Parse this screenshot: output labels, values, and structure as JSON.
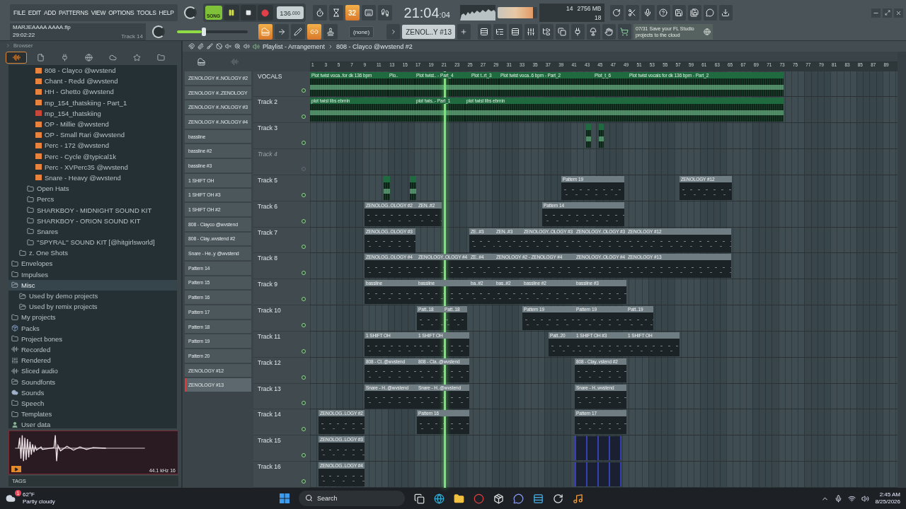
{
  "menu": [
    "FILE",
    "EDIT",
    "ADD",
    "PATTERNS",
    "VIEW",
    "OPTIONS",
    "TOOLS",
    "HELP"
  ],
  "project": {
    "file": "MARJEAAAA AAAA.flp",
    "time": "29:02:22",
    "track": "Track 14"
  },
  "transport": {
    "song_mode": true,
    "mode_label": "SONG",
    "playing": true,
    "tempo": "136",
    "tempo_fraction": ".000"
  },
  "toggles": [
    {
      "kind": "metronome",
      "on": false
    },
    {
      "kind": "wait",
      "on": false
    },
    {
      "kind": "step",
      "label": "32",
      "on": true
    },
    {
      "kind": "typing",
      "on": false
    },
    {
      "kind": "countdown",
      "on": false
    }
  ],
  "clock": {
    "main": "21:04",
    "sub": ":04"
  },
  "output_meter": {
    "level": 0.9
  },
  "master_volume": {
    "level": 0.35
  },
  "cpu": {
    "polyphony": "14",
    "memory": "2756 MB",
    "voices": "18"
  },
  "tools": [
    {
      "kind": "piano",
      "on": true
    },
    {
      "kind": "arrow",
      "on": false
    },
    {
      "kind": "pen",
      "on": false
    },
    {
      "kind": "link",
      "on": true
    },
    {
      "kind": "stamp",
      "on": false
    }
  ],
  "snap": "(none)",
  "pattern": "ZENOL..Y #13",
  "hint": {
    "counter": "07/31",
    "text": "Save your FL Studio projects to the cloud"
  },
  "browser": {
    "title": "Browser",
    "tabs": [
      {
        "kind": "wave",
        "selected": true
      },
      {
        "kind": "file",
        "selected": false
      },
      {
        "kind": "plug",
        "selected": false
      },
      {
        "kind": "globe",
        "selected": false
      },
      {
        "kind": "cloud",
        "selected": false
      },
      {
        "kind": "star",
        "selected": false
      },
      {
        "kind": "folder",
        "selected": false
      }
    ],
    "tree": [
      {
        "children": [
          {
            "children": [
              {
                "children": [
                  {
                    "label": "808 - Clayco @wvstend",
                    "kind": "file",
                    "selected": false
                  },
                  {
                    "label": "Chant - Redd @wvstend",
                    "kind": "file",
                    "selected": false
                  },
                  {
                    "label": "HH - Ghetto @wvstend",
                    "kind": "file",
                    "selected": false
                  },
                  {
                    "label": "mp_154_thatskiing - Part_1",
                    "kind": "file",
                    "selected": false
                  },
                  {
                    "label": "mp_154_thatskiing",
                    "kind": "audio",
                    "selected": false
                  },
                  {
                    "label": "OP - Millie @wvstend",
                    "kind": "file",
                    "selected": false
                  },
                  {
                    "label": "OP - Small Rari @wvstend",
                    "kind": "file",
                    "selected": false
                  },
                  {
                    "label": "Perc - 172 @wvstend",
                    "kind": "file",
                    "selected": false
                  },
                  {
                    "label": "Perc - Cycle @typical1k",
                    "kind": "file",
                    "selected": false
                  },
                  {
                    "label": "Perc - XVPerc35 @wvstend",
                    "kind": "file",
                    "selected": false
                  },
                  {
                    "label": "Snare - Heavy @wvstend",
                    "kind": "file",
                    "selected": false
                  }
                ]
              },
              {
                "label": "Open Hats",
                "kind": "folder",
                "selected": false
              },
              {
                "label": "Percs",
                "kind": "folder",
                "selected": false
              },
              {
                "label": "SHARKBOY - MIDNIGHT SOUND KIT",
                "kind": "folder",
                "selected": false
              },
              {
                "label": "SHARKBOY - ORION SOUND KIT",
                "kind": "folder",
                "selected": false
              },
              {
                "label": "Snares",
                "kind": "folder",
                "selected": false
              },
              {
                "label": "''SPYRAL'' SOUND KIT [@hitgirlsworld]",
                "kind": "folder",
                "selected": false
              }
            ]
          },
          {
            "label": "z. One Shots",
            "kind": "folder",
            "selected": false
          }
        ]
      },
      {
        "label": "Envelopes",
        "kind": "folder",
        "selected": false
      },
      {
        "label": "Impulses",
        "kind": "folder",
        "selected": false
      },
      {
        "label": "Misc",
        "kind": "plain",
        "selected": true,
        "children": [
          {
            "label": "Used by demo projects",
            "kind": "plain",
            "selected": false
          },
          {
            "label": "Used by remix projects",
            "kind": "plain",
            "selected": false
          }
        ]
      },
      {
        "label": "My projects",
        "kind": "folder",
        "selected": false
      },
      {
        "label": "Packs",
        "kind": "pack",
        "selected": false
      },
      {
        "label": "Project bones",
        "kind": "folder",
        "selected": false
      },
      {
        "label": "Recorded",
        "kind": "wave",
        "selected": false
      },
      {
        "label": "Rendered",
        "kind": "render",
        "selected": false
      },
      {
        "label": "Sliced audio",
        "kind": "wave",
        "selected": false
      },
      {
        "label": "Soundfonts",
        "kind": "plain",
        "selected": false
      },
      {
        "label": "Sounds",
        "kind": "cloud",
        "selected": false
      },
      {
        "label": "Speech",
        "kind": "folder",
        "selected": false
      },
      {
        "label": "Templates",
        "kind": "folder",
        "selected": false
      },
      {
        "label": "User data",
        "kind": "user",
        "selected": false
      }
    ],
    "preview": {
      "info": "44.1 kHz 16"
    },
    "tags": "TAGS"
  },
  "playlist": {
    "title": "Playlist - Arrangement",
    "pattern": "808 - Clayco @wvstend #2",
    "picker": [
      {
        "label": "ZENOLOGY #..NOLOGY #2",
        "selected": false
      },
      {
        "label": "ZENOLOGY #..ZENOLOGY",
        "selected": false
      },
      {
        "label": "ZENOLOGY #..NOLOGY #3",
        "selected": false
      },
      {
        "label": "ZENOLOGY #..NOLOGY #4",
        "selected": false
      },
      {
        "label": "bassline",
        "selected": false
      },
      {
        "label": "bassline #2",
        "selected": false
      },
      {
        "label": "bassline #3",
        "selected": false
      },
      {
        "label": "1 SHIFT OH",
        "selected": false
      },
      {
        "label": "1 SHIFT OH #3",
        "selected": false
      },
      {
        "label": "1 SHIFT OH #2",
        "selected": false
      },
      {
        "label": "808 - Clayco @wvstend",
        "selected": false
      },
      {
        "label": "808 - Clay..wvstend #2",
        "selected": false
      },
      {
        "label": "Snare - He..y @wvstend",
        "selected": false
      },
      {
        "label": "Pattern 14",
        "selected": false
      },
      {
        "label": "Pattern 15",
        "selected": false
      },
      {
        "label": "Pattern 16",
        "selected": false
      },
      {
        "label": "Pattern 17",
        "selected": false
      },
      {
        "label": "Pattern 18",
        "selected": false
      },
      {
        "label": "Pattern 19",
        "selected": false
      },
      {
        "label": "Pattern 20",
        "selected": false
      },
      {
        "label": "ZENOLOGY #12",
        "selected": false
      },
      {
        "label": "ZENOLOGY #13",
        "selected": true
      }
    ],
    "ruler": [
      "1",
      "3",
      "5",
      "7",
      "9",
      "11",
      "13",
      "15",
      "17",
      "19",
      "21",
      "23",
      "25",
      "27",
      "29",
      "31",
      "33",
      "35",
      "37",
      "39",
      "41",
      "43",
      "45",
      "47",
      "49",
      "51",
      "53",
      "55",
      "57",
      "59",
      "61",
      "63",
      "65",
      "67",
      "69",
      "71",
      "73",
      "75",
      "77",
      "79",
      "81",
      "83",
      "85",
      "87",
      "89"
    ],
    "tracks": [
      {
        "name": "VOCALS",
        "muted": false,
        "clips": [
          {
            "kind": "audio",
            "label": "Plot twist voca..for dk 136 bpm"
          },
          {
            "kind": "audio",
            "label": "Plo.."
          },
          {
            "kind": "audio",
            "label": "Plot twist.. - Part_4"
          },
          {
            "kind": "audio",
            "label": "Plot t..rt_3"
          },
          {
            "kind": "audio",
            "label": "Plot twist voca..6 bpm - Part_2"
          },
          {
            "kind": "audio"
          },
          {
            "kind": "audio",
            "label": "Plot_t_6"
          },
          {
            "kind": "audio",
            "label": "Plot twist vocals for dk 136 bpm - Part_2"
          }
        ]
      },
      {
        "name": "Track 2",
        "muted": false,
        "clips": [
          {
            "kind": "audio",
            "label": "plot twist libs ebmin"
          },
          {
            "kind": "audio",
            "label": "plot twis..- Part_1"
          },
          {
            "kind": "audio",
            "label": "plot twist libs ebmin"
          }
        ]
      },
      {
        "name": "Track 3",
        "muted": false,
        "clips": [
          {
            "kind": "audio"
          },
          {
            "kind": "audio"
          }
        ]
      },
      {
        "name": "Track 4",
        "muted": true
      },
      {
        "name": "Track 5",
        "muted": false,
        "clips": [
          {
            "kind": "audio"
          },
          {
            "kind": "audio"
          },
          {
            "kind": "pattern",
            "label": "Pattern 19"
          },
          {
            "kind": "pattern",
            "label": "ZENOLOGY #12"
          }
        ]
      },
      {
        "name": "Track 6",
        "muted": false,
        "clips": [
          {
            "kind": "pattern",
            "label": "ZENOLOG..OLOGY #2"
          },
          {
            "kind": "pattern",
            "label": "ZEN..#2"
          },
          {
            "kind": "pattern",
            "label": "Pattern 14"
          }
        ]
      },
      {
        "name": "Track 7",
        "muted": false,
        "clips": [
          {
            "kind": "pattern",
            "label": "ZENOLOG..OLOGY #3"
          },
          {
            "kind": "pattern",
            "label": "ZE..#3"
          },
          {
            "kind": "pattern",
            "label": "ZEN..#3"
          },
          {
            "kind": "pattern",
            "label": "ZENOLOGY..OLOGY #3"
          },
          {
            "kind": "pattern",
            "label": "ZENOLOGY..OLOGY #3"
          },
          {
            "kind": "pattern",
            "label": "ZENOLOGY #12"
          }
        ]
      },
      {
        "name": "Track 8",
        "muted": false,
        "clips": [
          {
            "kind": "pattern",
            "label": "ZENOLOG..OLOGY #4"
          },
          {
            "kind": "pattern",
            "label": "ZENOLOGY..OLOGY #4"
          },
          {
            "kind": "pattern",
            "label": "ZE..#4"
          },
          {
            "kind": "pattern",
            "label": "ZENOLOGY #2 - ZENOLOGY #4"
          },
          {
            "kind": "pattern",
            "label": "ZENOLOGY..OLOGY #4"
          },
          {
            "kind": "pattern",
            "label": "ZENOLOGY #13"
          }
        ]
      },
      {
        "name": "Track 9",
        "muted": false,
        "clips": [
          {
            "kind": "pattern",
            "label": "bassline"
          },
          {
            "kind": "pattern",
            "label": "bassline"
          },
          {
            "kind": "pattern",
            "label": "ba..#2"
          },
          {
            "kind": "pattern",
            "label": "bas..#2"
          },
          {
            "kind": "pattern",
            "label": "bassline #2"
          },
          {
            "kind": "pattern",
            "label": "bassline #3"
          }
        ]
      },
      {
        "name": "Track 10",
        "muted": false,
        "clips": [
          {
            "kind": "pattern",
            "label": "Patt..18"
          },
          {
            "kind": "pattern",
            "label": "Patt..18"
          },
          {
            "kind": "pattern",
            "label": "Pattern 19"
          },
          {
            "kind": "pattern",
            "label": "Pattern 19"
          },
          {
            "kind": "pattern",
            "label": "Patt..19"
          }
        ]
      },
      {
        "name": "Track 11",
        "muted": false,
        "clips": [
          {
            "kind": "pattern",
            "label": "1 SHIFT OH"
          },
          {
            "kind": "pattern",
            "label": "1 SHIFT OH"
          },
          {
            "kind": "pattern",
            "label": "Patt..20"
          },
          {
            "kind": "pattern",
            "label": "1 SHIFT OH #3"
          },
          {
            "kind": "pattern",
            "label": "1 SHIFT OH"
          }
        ]
      },
      {
        "name": "Track 12",
        "muted": false,
        "clips": [
          {
            "kind": "pattern",
            "label": "808 - Cl..@wvstend"
          },
          {
            "kind": "pattern",
            "label": "808 - Cla..@wvstend"
          },
          {
            "kind": "pattern",
            "label": "808 - Clay..vstend #2"
          }
        ]
      },
      {
        "name": "Track 13",
        "muted": false,
        "clips": [
          {
            "kind": "pattern",
            "label": "Snare - H..@wvstend"
          },
          {
            "kind": "pattern",
            "label": "Snare - H..@wvstend"
          },
          {
            "kind": "pattern",
            "label": "Snare - H..wvstend"
          }
        ]
      },
      {
        "name": "Track 14",
        "muted": false,
        "clips": [
          {
            "kind": "pattern",
            "label": "ZENOLOG..LOGY #2"
          },
          {
            "kind": "pattern",
            "label": "Pattern 16"
          },
          {
            "kind": "pattern",
            "label": "Pattern 17"
          }
        ]
      },
      {
        "name": "Track 15",
        "muted": false,
        "clips": [
          {
            "kind": "pattern",
            "label": "ZENOLOG..LOGY #3"
          },
          {
            "kind": "slice"
          }
        ]
      },
      {
        "name": "Track 16",
        "muted": false,
        "clips": [
          {
            "kind": "pattern",
            "label": "ZENOLOG..LOGY #4"
          },
          {
            "kind": "slice"
          }
        ]
      }
    ]
  },
  "taskbar": {
    "temperature": "62°F",
    "condition": "Partly cloudy",
    "badge": "1",
    "search": {
      "placeholder": "Search"
    },
    "time": "2:45 AM",
    "date": "8/25/2026"
  }
}
